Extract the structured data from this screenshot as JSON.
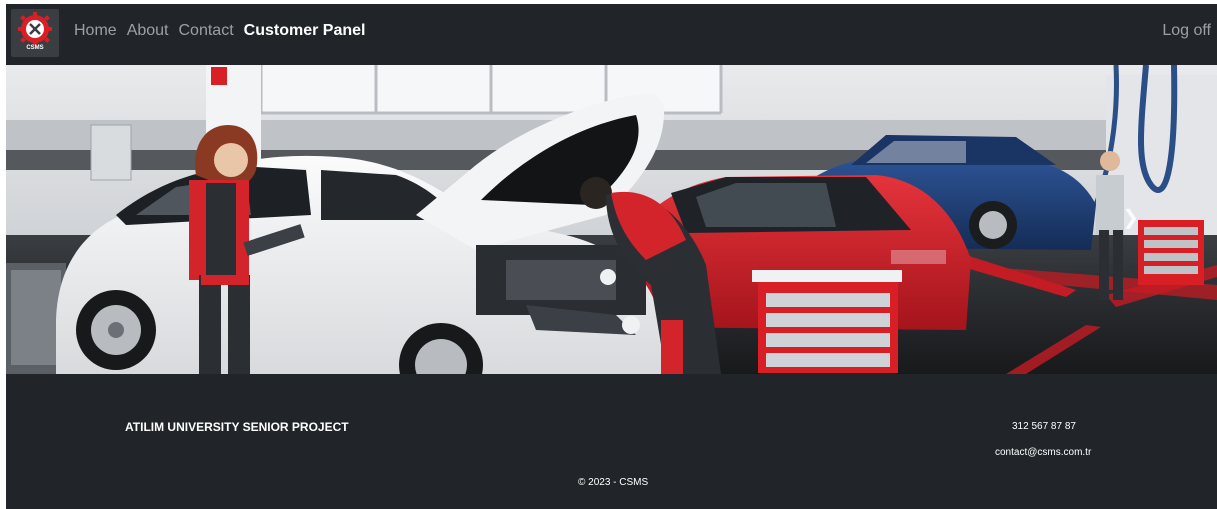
{
  "brand": {
    "logo_text": "CSMS"
  },
  "nav": {
    "items": [
      {
        "label": "Home"
      },
      {
        "label": "About"
      },
      {
        "label": "Contact"
      },
      {
        "label": "Customer Panel"
      }
    ],
    "logoff": "Log off"
  },
  "hero": {
    "next_icon": "chevron-right-icon"
  },
  "footer": {
    "project": "ATILIM UNIVERSITY SENIOR PROJECT",
    "phone": "312 567 87 87",
    "email": "contact@csms.com.tr",
    "copyright": "© 2023 - CSMS"
  },
  "colors": {
    "dark": "#212529",
    "nav_muted": "#9aa0a6",
    "accent_red": "#d91f26",
    "car_white": "#f2f3f5",
    "car_red": "#d4202a",
    "car_blue": "#1f3f78"
  }
}
